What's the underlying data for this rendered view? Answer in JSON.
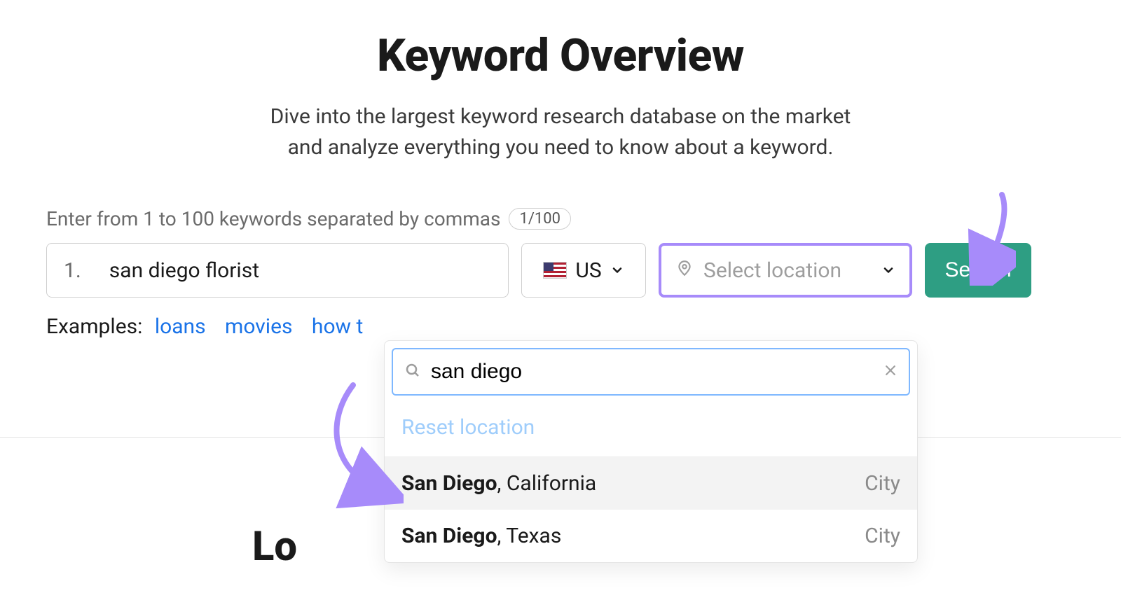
{
  "header": {
    "title": "Keyword Overview",
    "subtitle_line1": "Dive into the largest keyword research database on the market",
    "subtitle_line2": "and analyze everything you need to know about a keyword."
  },
  "form": {
    "helper_text": "Enter from 1 to 100 keywords separated by commas",
    "count_badge": "1/100",
    "keyword_prefix": "1.",
    "keyword_value": "san diego florist",
    "country_label": "US",
    "location_placeholder": "Select location",
    "search_button": "Search"
  },
  "examples": {
    "label": "Examples:",
    "items": [
      "loans",
      "movies",
      "how t"
    ]
  },
  "dropdown": {
    "search_value": "san diego",
    "reset_label": "Reset location",
    "results": [
      {
        "match": "San Diego",
        "rest": ", California",
        "type": "City",
        "highlighted": true
      },
      {
        "match": "San Diego",
        "rest": ", Texas",
        "type": "City",
        "highlighted": false
      }
    ]
  },
  "section_fragment": "Lo",
  "colors": {
    "accent_purple": "#a78bfa",
    "primary_green": "#2e9e83",
    "link_blue": "#1a73e8"
  },
  "icons": {
    "chevron_down": "chevron-down-icon",
    "pin": "pin-icon",
    "search": "search-icon",
    "close": "close-icon",
    "flag_us": "flag-us-icon"
  }
}
